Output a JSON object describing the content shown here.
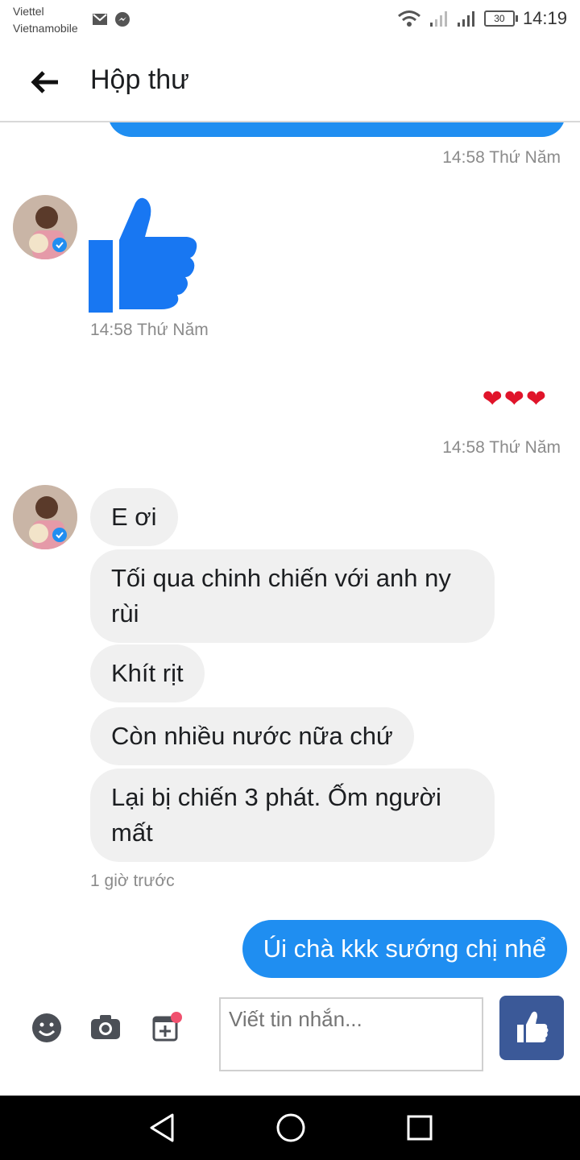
{
  "status_bar": {
    "carrier_1": "Viettel",
    "carrier_2": "Vietnamobile",
    "battery": "30",
    "time": "14:19",
    "icons": [
      "gmail-icon",
      "messenger-icon",
      "wifi-icon",
      "signal-icon",
      "signal-icon",
      "battery-icon"
    ]
  },
  "header": {
    "title": "Hộp thư",
    "back_icon": "arrow-left-icon"
  },
  "messages": {
    "ts_1": "14:58 Thứ Năm",
    "ts_2": "14:58 Thứ Năm",
    "ts_3": "14:58 Thứ Năm",
    "hearts": "❤❤❤",
    "incoming": [
      "E ơi",
      "Tối qua chinh chiến với anh ny rùi",
      "Khít rịt",
      "Còn nhiều nước nữa chứ",
      "Lại bị chiến 3 phát. Ốm người mất"
    ],
    "ts_4": "1 giờ trước",
    "outgoing": "Úi chà kkk sướng chị nhể"
  },
  "composer": {
    "placeholder": "Viết tin nhắn...",
    "icons": [
      "emoji-icon",
      "camera-icon",
      "sticker-add-icon",
      "like-icon"
    ]
  },
  "colors": {
    "accent": "#1f8ef1",
    "like_button": "#3b5998",
    "incoming_bubble": "#f0f0f0",
    "heart": "#e0142a"
  }
}
